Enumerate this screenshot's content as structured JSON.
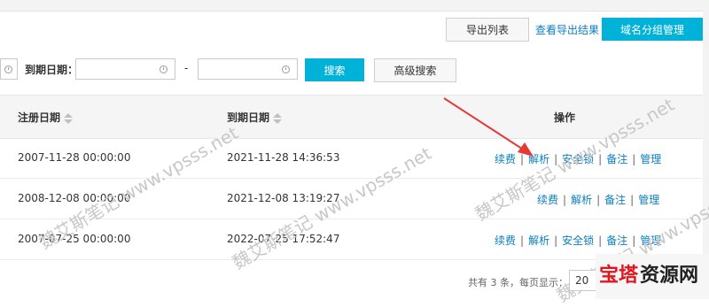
{
  "toolbar": {
    "export_list": "导出列表",
    "view_export": "查看导出结果",
    "domain_group": "域名分组管理"
  },
  "search": {
    "expire_label": "到期日期：",
    "range_sep": "-",
    "search_btn": "搜索",
    "advanced_btn": "高级搜索"
  },
  "table": {
    "headers": {
      "reg_date": "注册日期",
      "exp_date": "到期日期",
      "ops": "操作"
    },
    "rows": [
      {
        "reg": "2007-11-28 00:00:00",
        "exp": "2021-11-28 14:36:53",
        "ops": [
          "续费",
          "解析",
          "安全锁",
          "备注",
          "管理"
        ]
      },
      {
        "reg": "2008-12-08 00:00:00",
        "exp": "2021-12-08 13:19:27",
        "ops": [
          "续费",
          "解析",
          "备注",
          "管理"
        ]
      },
      {
        "reg": "2007-07-25 00:00:00",
        "exp": "2022-07-25 17:52:47",
        "ops": [
          "续费",
          "解析",
          "安全锁",
          "备注",
          "管理"
        ]
      }
    ],
    "sep": "|"
  },
  "pager": {
    "text": "共有 3 条，每页显示：",
    "page_size": "20"
  },
  "watermark": {
    "text1": "魏艾斯笔记",
    "text2": "www.vpsss.net"
  },
  "brand": {
    "red": "宝塔",
    "black": "资源网"
  },
  "colors": {
    "primary": "#00b1d8",
    "link": "#0b7ec0",
    "arrow": "#e53935",
    "brand_red": "#e0161c"
  }
}
